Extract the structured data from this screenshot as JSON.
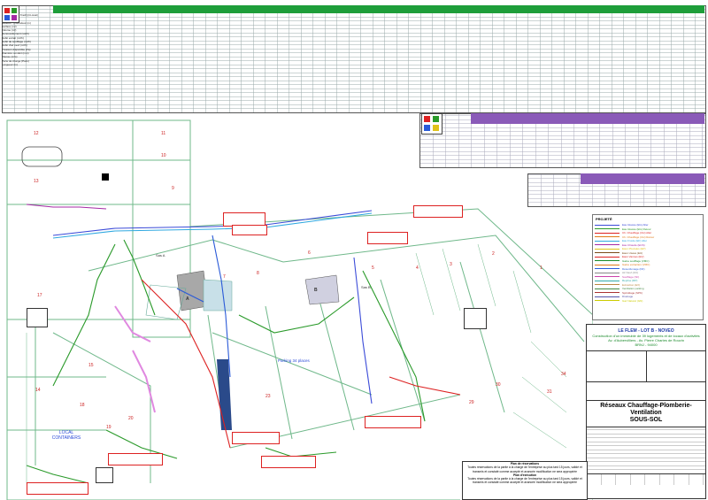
{
  "project": {
    "name": "LE FLEM - LOT B - NOVEO",
    "description": "Construction d'un immeuble de 39 logements et de locaux d'activités",
    "address": "Av. d'Aubervilliers - Av. Pierre Charles de Rouvin",
    "code": "BRNJ - 94000"
  },
  "sheet": {
    "title": "Réseaux Chauffage-Plomberie-Ventilation",
    "level": "SOUS-SOL"
  },
  "notes": {
    "top": "Plan de réservations",
    "top_text": "Toutes réservations de la partie à la charge de l'entreprise au plus tard 15 jours, validé et transmis et constaté comme accepté et avancée modification ne sera appropriée",
    "bottom": "Plan d'exécution",
    "bottom_text": "Toutes réservations de la partie à la charge de l'entreprise au plus tard 15 jours, validé et transmis et constaté comme accepté et avancée modification ne sera appropriée"
  },
  "legend": {
    "title": "PROJETÉ",
    "items": [
      {
        "label": "Eau Glacée (EG) Aller",
        "color": "#3b4bd8"
      },
      {
        "label": "Eau Glacée (EG) Retour",
        "color": "#2a9a2a"
      },
      {
        "label": "Ch. Chauffage (CH) Aller",
        "color": "#d22"
      },
      {
        "label": "Ch. Chauffage (CH) Retour",
        "color": "#e07a1a"
      },
      {
        "label": "Eau Froide (EF) Aller",
        "color": "#2fa8e0"
      },
      {
        "label": "Eau Chaude (ECS)",
        "color": "#a52aa5"
      },
      {
        "label": "Eaux Pluviales (EP)",
        "color": "#e0c21a"
      },
      {
        "label": "Eaux Usées (EU)",
        "color": "#7a4a1a"
      },
      {
        "label": "Eaux Vannes (EV)",
        "color": "#d22"
      },
      {
        "label": "Gaine soufflage (VMC)",
        "color": "#1a8a2a"
      },
      {
        "label": "Gaine extraction (VMC)",
        "color": "#e07a1a"
      },
      {
        "label": "Désenfumage (DF)",
        "color": "#2a5ad8"
      },
      {
        "label": "Air Neuf (AN)",
        "color": "#888"
      },
      {
        "label": "Soufflage (SF)",
        "color": "#c4a"
      },
      {
        "label": "Reprise (RP)",
        "color": "#3aa"
      },
      {
        "label": "Extraction (EX)",
        "color": "#b84"
      },
      {
        "label": "Ventilation parking",
        "color": "#484"
      },
      {
        "label": "Sprinklage (SPK)",
        "color": "#a33"
      },
      {
        "label": "Drainage",
        "color": "#55a"
      },
      {
        "label": "Gaz Naturel (GN)",
        "color": "#cc0"
      }
    ]
  },
  "rooms": [
    "12",
    "11",
    "10",
    "13",
    "9",
    "8",
    "7",
    "A",
    "B",
    "6",
    "5",
    "4",
    "3",
    "2",
    "1",
    "17",
    "16",
    "15",
    "14",
    "18",
    "19",
    "20",
    "21",
    "22",
    "23",
    "24",
    "25",
    "26",
    "27",
    "28",
    "29",
    "30",
    "31",
    "32",
    "33",
    "34"
  ],
  "labels": {
    "local_containers": "LOCAL CONTAINERS",
    "parking": "Parking 34 places",
    "sas_a": "Sas A",
    "sas_b": "Sas B"
  },
  "table_headers": [
    "Pit. max. (Coef.Trach)(Ci-Aval)",
    "Largeur (m)",
    "Hauteur / profondeur (m)",
    "Surface (m²)",
    "Volume (m³)",
    "Renouvellement (vol/h)",
    "Débit extrait (m³/h)",
    "Débit de soufflage (m³/h)",
    "Débit d'air neuf (m³/h)",
    "Pression disponible (Pa)",
    "Diamètre conduit (mm)",
    "Vitesse (m/s)",
    "Perte de charge (Pa/m)",
    "Longueur (m)"
  ],
  "colors": {
    "green_header": "#1e9e3a",
    "wall": "#6fb88a",
    "brand_blue": "#1b38a6"
  }
}
